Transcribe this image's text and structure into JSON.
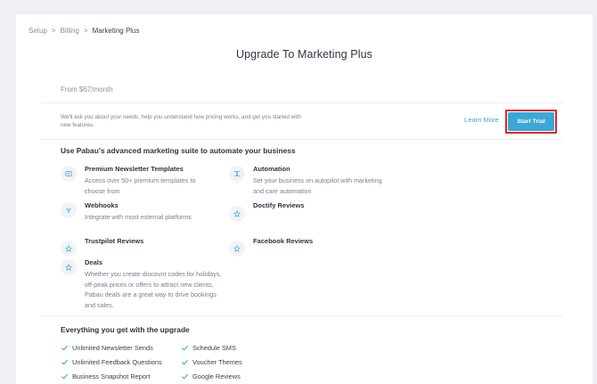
{
  "breadcrumb": {
    "items": [
      "Setup",
      "Billing"
    ],
    "current": "Marketing Plus",
    "separator": ">"
  },
  "page": {
    "title": "Upgrade To Marketing Plus",
    "price": "From $67/month",
    "description": "We'll ask you about your needs, help you understand how pricing works, and get you started with new features.",
    "learn_more": "Learn More",
    "start_trial": "Start Trial"
  },
  "suite": {
    "title": "Use Pabau's advanced marketing suite to automate your business",
    "features": [
      {
        "title": "Premium Newsletter Templates",
        "description": "Access over 50+ premium templates to choose from",
        "icon": "newsletter-icon"
      },
      {
        "title": "Automation",
        "description": "Set your business on autopilot with marketing and care automation",
        "icon": "automation-icon"
      },
      {
        "title": "Webhooks",
        "description": "Integrate with most external platforms",
        "icon": "webhook-icon"
      },
      {
        "title": "Doctify Reviews",
        "description": "",
        "icon": "star-icon"
      },
      {
        "title": "Trustpilot Reviews",
        "description": "",
        "icon": "star-icon"
      },
      {
        "title": "Facebook Reviews",
        "description": "",
        "icon": "star-icon"
      },
      {
        "title": "Deals",
        "description": "Whether you create discount codes for holidays, off-peak prices or offers to attract new clients, Pabau deals are a great way to drive bookings and sales.",
        "icon": "star-icon"
      }
    ]
  },
  "upgrade": {
    "title": "Everything you get with the upgrade",
    "benefits_left": [
      "Unlimited Newsletter Sends",
      "Unlimited Feedback Questions",
      "Business Snapshot Report"
    ],
    "benefits_right": [
      "Schedule SMS",
      "Voucher Themes",
      "Google Reviews"
    ]
  },
  "colors": {
    "accent": "#3aa7d6",
    "highlight": "#e02424",
    "check": "#3aa7d6"
  }
}
